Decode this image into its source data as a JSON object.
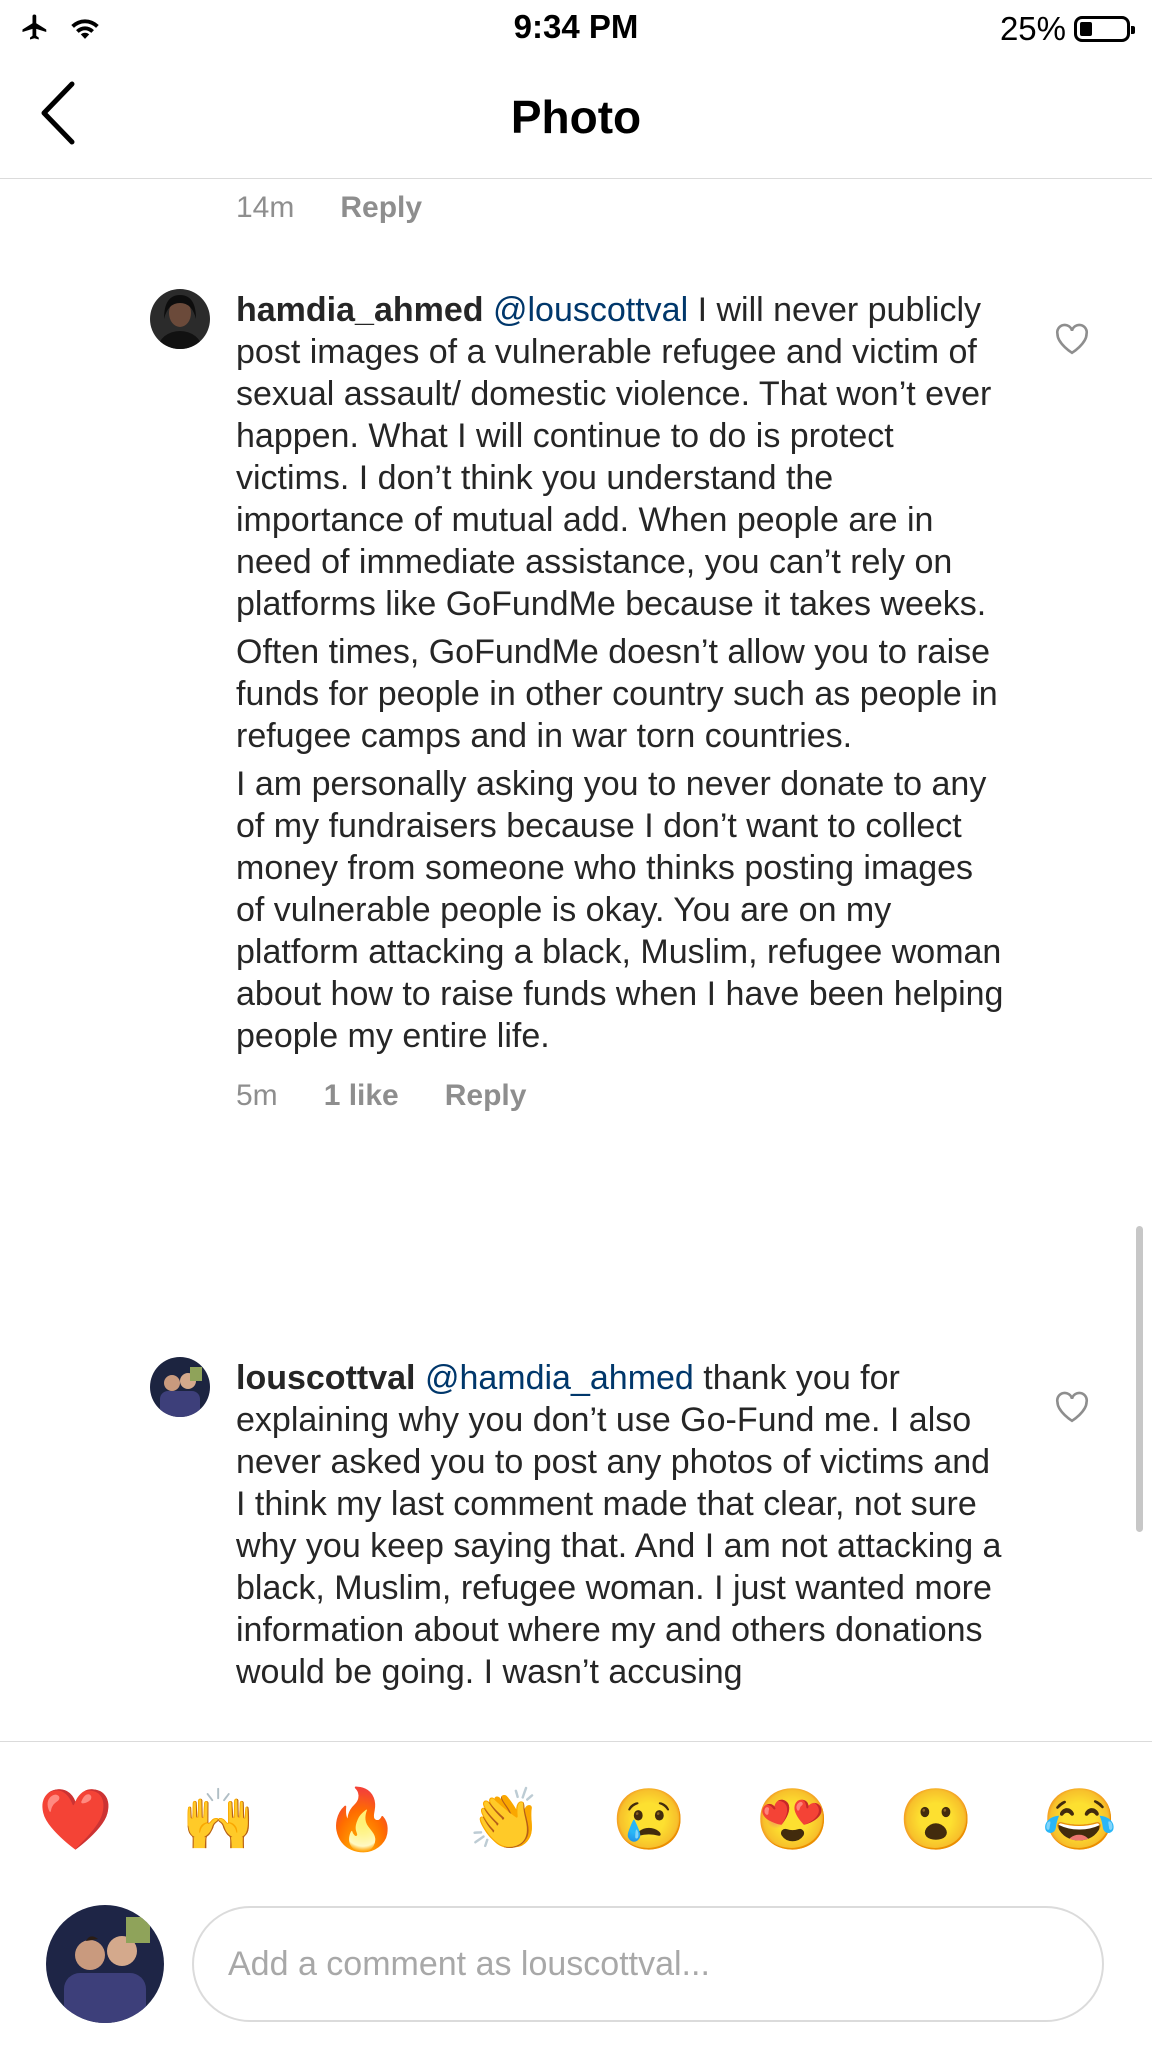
{
  "status_bar": {
    "time": "9:34 PM",
    "battery": "25%",
    "icons": [
      "airplane-icon",
      "wifi-icon",
      "battery-icon"
    ]
  },
  "nav": {
    "title": "Photo",
    "back_icon": "chevron-left-icon"
  },
  "previous_comment_meta": {
    "time": "14m",
    "reply": "Reply"
  },
  "comments": [
    {
      "username": "hamdia_ahmed",
      "mention": "@louscottval",
      "paragraphs": [
        " I will never publicly post images of a vulnerable refugee and victim of sexual assault/ domestic violence. That won’t ever happen. What I will continue  to do is protect victims. I don’t think you understand the importance of mutual add. When people are in need of immediate assistance, you can’t rely on platforms like GoFundMe because it takes weeks.",
        "Often times, GoFundMe doesn’t allow you to raise funds for people in other country such as people in refugee camps and in war torn countries.",
        "I am personally asking you to never donate to any of my fundraisers because I don’t want to collect money from someone who thinks posting images of vulnerable people is okay. You are on my platform attacking a black, Muslim, refugee woman about how to raise funds when I have been helping people my entire life."
      ],
      "time": "5m",
      "likes": "1 like",
      "reply": "Reply"
    },
    {
      "username": "louscottval",
      "mention": "@hamdia_ahmed",
      "paragraphs": [
        " thank you for explaining why you don’t use Go-Fund me. I also never asked you to post any photos of victims and I think my last comment made that clear, not sure why you keep saying that. And I am not attacking a black, Muslim, refugee woman. I just wanted more information about where my and others donations would be going. I wasn’t accusing"
      ]
    }
  ],
  "emoji_bar": [
    "❤️",
    "🙌",
    "🔥",
    "👏",
    "😢",
    "😍",
    "😮",
    "😂"
  ],
  "comment_input": {
    "placeholder": "Add a comment as louscottval..."
  },
  "colors": {
    "mention": "#00376b",
    "meta": "#8e8e8e",
    "text": "#262626",
    "divider": "#dbdbdb"
  }
}
